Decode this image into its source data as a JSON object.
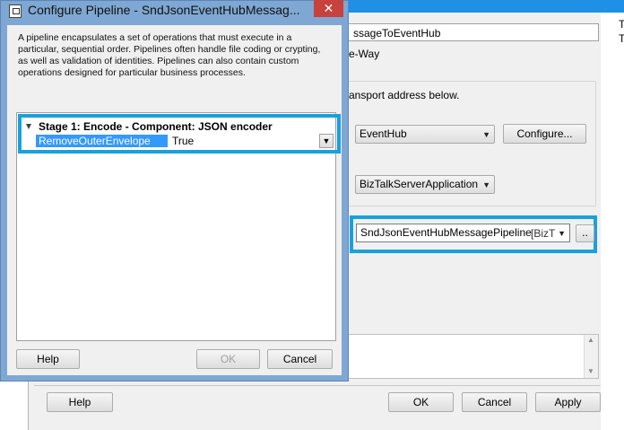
{
  "background_window": {
    "right_t1": "T",
    "right_t2": "T",
    "name_field_value": "ssageToEventHub",
    "oneway_text": "e-Way",
    "transport_text": "ansport address below.",
    "transport_type": "EventHub",
    "configure_label": "Configure...",
    "handler_value": "BizTalkServerApplication",
    "pipeline_value": "SndJsonEventHubMessagePipeline",
    "pipeline_suffix": "[BizT",
    "ellipsis_label": "..",
    "help_label": "Help",
    "ok_label": "OK",
    "cancel_label": "Cancel",
    "apply_label": "Apply"
  },
  "dialog": {
    "title": "Configure Pipeline - SndJsonEventHubMessag...",
    "close_glyph": "✕",
    "description_lines": [
      "A pipeline encapsulates a set of operations that must execute in a",
      "particular, sequential order. Pipelines often handle file coding or crypting,",
      "as well as validation of identities. Pipelines can also contain custom",
      "operations designed for particular business processes."
    ],
    "stage_label": "Stage 1: Encode - Component: JSON encoder",
    "property": {
      "name": "RemoveOuterEnvelope",
      "value": "True"
    },
    "help_label": "Help",
    "ok_label": "OK",
    "cancel_label": "Cancel"
  },
  "colors": {
    "highlight": "#1aa0dc",
    "titlebar": "#7fa7d3",
    "selection": "#3399ff",
    "close": "#c7423c"
  }
}
